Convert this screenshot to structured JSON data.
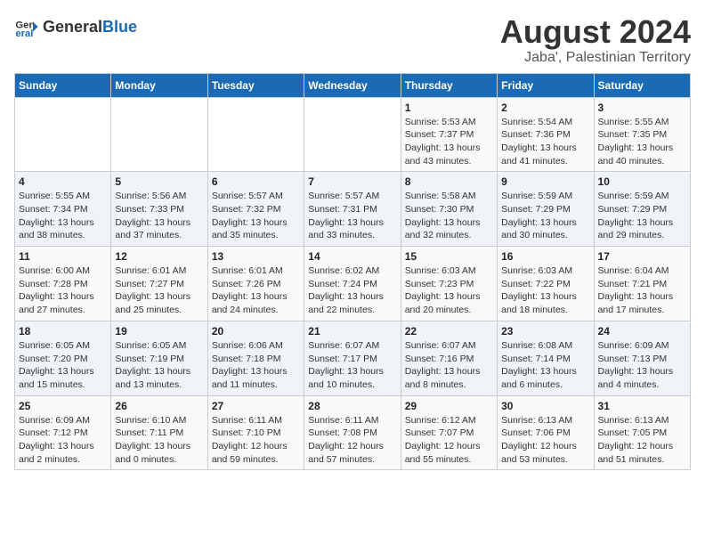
{
  "logo": {
    "text_general": "General",
    "text_blue": "Blue",
    "icon_symbol": "▶"
  },
  "title": "August 2024",
  "subtitle": "Jaba', Palestinian Territory",
  "days_of_week": [
    "Sunday",
    "Monday",
    "Tuesday",
    "Wednesday",
    "Thursday",
    "Friday",
    "Saturday"
  ],
  "weeks": [
    [
      {
        "day": "",
        "info": ""
      },
      {
        "day": "",
        "info": ""
      },
      {
        "day": "",
        "info": ""
      },
      {
        "day": "",
        "info": ""
      },
      {
        "day": "1",
        "info": "Sunrise: 5:53 AM\nSunset: 7:37 PM\nDaylight: 13 hours and 43 minutes."
      },
      {
        "day": "2",
        "info": "Sunrise: 5:54 AM\nSunset: 7:36 PM\nDaylight: 13 hours and 41 minutes."
      },
      {
        "day": "3",
        "info": "Sunrise: 5:55 AM\nSunset: 7:35 PM\nDaylight: 13 hours and 40 minutes."
      }
    ],
    [
      {
        "day": "4",
        "info": "Sunrise: 5:55 AM\nSunset: 7:34 PM\nDaylight: 13 hours and 38 minutes."
      },
      {
        "day": "5",
        "info": "Sunrise: 5:56 AM\nSunset: 7:33 PM\nDaylight: 13 hours and 37 minutes."
      },
      {
        "day": "6",
        "info": "Sunrise: 5:57 AM\nSunset: 7:32 PM\nDaylight: 13 hours and 35 minutes."
      },
      {
        "day": "7",
        "info": "Sunrise: 5:57 AM\nSunset: 7:31 PM\nDaylight: 13 hours and 33 minutes."
      },
      {
        "day": "8",
        "info": "Sunrise: 5:58 AM\nSunset: 7:30 PM\nDaylight: 13 hours and 32 minutes."
      },
      {
        "day": "9",
        "info": "Sunrise: 5:59 AM\nSunset: 7:29 PM\nDaylight: 13 hours and 30 minutes."
      },
      {
        "day": "10",
        "info": "Sunrise: 5:59 AM\nSunset: 7:29 PM\nDaylight: 13 hours and 29 minutes."
      }
    ],
    [
      {
        "day": "11",
        "info": "Sunrise: 6:00 AM\nSunset: 7:28 PM\nDaylight: 13 hours and 27 minutes."
      },
      {
        "day": "12",
        "info": "Sunrise: 6:01 AM\nSunset: 7:27 PM\nDaylight: 13 hours and 25 minutes."
      },
      {
        "day": "13",
        "info": "Sunrise: 6:01 AM\nSunset: 7:26 PM\nDaylight: 13 hours and 24 minutes."
      },
      {
        "day": "14",
        "info": "Sunrise: 6:02 AM\nSunset: 7:24 PM\nDaylight: 13 hours and 22 minutes."
      },
      {
        "day": "15",
        "info": "Sunrise: 6:03 AM\nSunset: 7:23 PM\nDaylight: 13 hours and 20 minutes."
      },
      {
        "day": "16",
        "info": "Sunrise: 6:03 AM\nSunset: 7:22 PM\nDaylight: 13 hours and 18 minutes."
      },
      {
        "day": "17",
        "info": "Sunrise: 6:04 AM\nSunset: 7:21 PM\nDaylight: 13 hours and 17 minutes."
      }
    ],
    [
      {
        "day": "18",
        "info": "Sunrise: 6:05 AM\nSunset: 7:20 PM\nDaylight: 13 hours and 15 minutes."
      },
      {
        "day": "19",
        "info": "Sunrise: 6:05 AM\nSunset: 7:19 PM\nDaylight: 13 hours and 13 minutes."
      },
      {
        "day": "20",
        "info": "Sunrise: 6:06 AM\nSunset: 7:18 PM\nDaylight: 13 hours and 11 minutes."
      },
      {
        "day": "21",
        "info": "Sunrise: 6:07 AM\nSunset: 7:17 PM\nDaylight: 13 hours and 10 minutes."
      },
      {
        "day": "22",
        "info": "Sunrise: 6:07 AM\nSunset: 7:16 PM\nDaylight: 13 hours and 8 minutes."
      },
      {
        "day": "23",
        "info": "Sunrise: 6:08 AM\nSunset: 7:14 PM\nDaylight: 13 hours and 6 minutes."
      },
      {
        "day": "24",
        "info": "Sunrise: 6:09 AM\nSunset: 7:13 PM\nDaylight: 13 hours and 4 minutes."
      }
    ],
    [
      {
        "day": "25",
        "info": "Sunrise: 6:09 AM\nSunset: 7:12 PM\nDaylight: 13 hours and 2 minutes."
      },
      {
        "day": "26",
        "info": "Sunrise: 6:10 AM\nSunset: 7:11 PM\nDaylight: 13 hours and 0 minutes."
      },
      {
        "day": "27",
        "info": "Sunrise: 6:11 AM\nSunset: 7:10 PM\nDaylight: 12 hours and 59 minutes."
      },
      {
        "day": "28",
        "info": "Sunrise: 6:11 AM\nSunset: 7:08 PM\nDaylight: 12 hours and 57 minutes."
      },
      {
        "day": "29",
        "info": "Sunrise: 6:12 AM\nSunset: 7:07 PM\nDaylight: 12 hours and 55 minutes."
      },
      {
        "day": "30",
        "info": "Sunrise: 6:13 AM\nSunset: 7:06 PM\nDaylight: 12 hours and 53 minutes."
      },
      {
        "day": "31",
        "info": "Sunrise: 6:13 AM\nSunset: 7:05 PM\nDaylight: 12 hours and 51 minutes."
      }
    ]
  ]
}
